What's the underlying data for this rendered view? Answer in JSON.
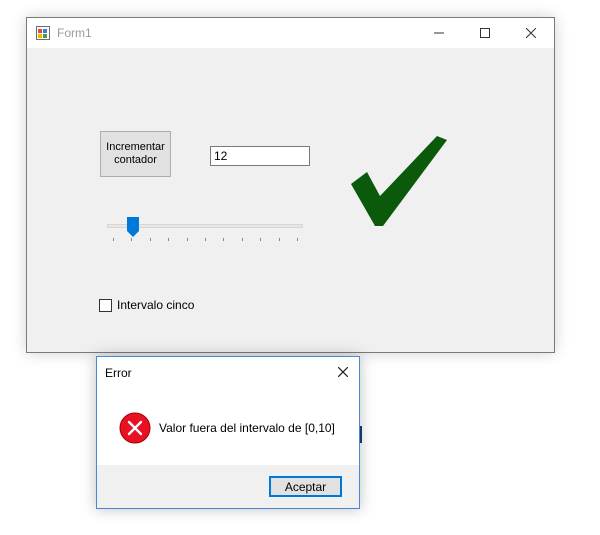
{
  "window": {
    "title": "Form1",
    "controls": {
      "minimize_icon": "minimize-icon",
      "maximize_icon": "maximize-icon",
      "close_icon": "close-icon"
    }
  },
  "form": {
    "increment_button_label": "Incrementar\ncontador",
    "counter_value": "12",
    "slider": {
      "min": 0,
      "max": 10,
      "value": 1,
      "tick_count": 11
    },
    "checkbox": {
      "label": "Intervalo cinco",
      "checked": false
    },
    "status_icon": "checkmark-icon",
    "status_color": "#0b5a0b"
  },
  "dialog": {
    "title": "Error",
    "message": "Valor fuera del intervalo de [0,10]",
    "icon": "error-icon",
    "icon_color": "#e81123",
    "accept_label": "Aceptar"
  },
  "colors": {
    "accent": "#0078d7"
  }
}
